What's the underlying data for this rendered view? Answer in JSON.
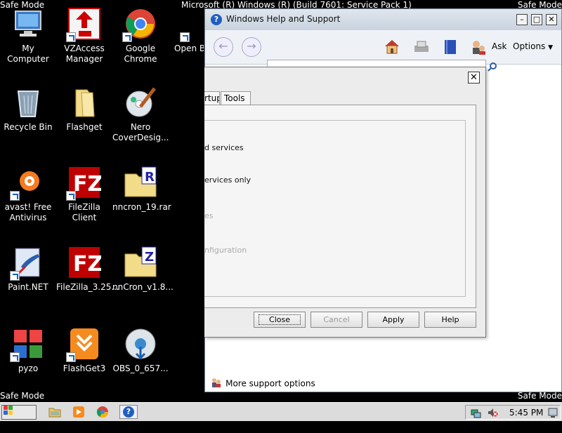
{
  "desktop": {
    "safe_mode": "Safe Mode",
    "os_title": "Microsoft (R) Windows (R) (Build 7601: Service Pack 1)",
    "icons": [
      {
        "label": "My Computer"
      },
      {
        "label": "VZAccess Manager"
      },
      {
        "label": "Google Chrome"
      },
      {
        "label": "Open Broadca"
      },
      {
        "label": "Recycle Bin"
      },
      {
        "label": "Flashget"
      },
      {
        "label": "Nero CoverDesig..."
      },
      {
        "label": "avast! Free Antivirus"
      },
      {
        "label": "FileZilla Client"
      },
      {
        "label": "nncron_19.rar"
      },
      {
        "label": "Paint.NET"
      },
      {
        "label": "FileZilla_3.25..."
      },
      {
        "label": "nnCron_v1.8..."
      },
      {
        "label": "pyzo"
      },
      {
        "label": "FlashGet3"
      },
      {
        "label": "OBS_0_657..."
      }
    ]
  },
  "help_window": {
    "title": "Windows Help and Support",
    "ask_label": "Ask",
    "options_label": "Options",
    "more_support": "More support options"
  },
  "dialog": {
    "tabs": [
      "rtup",
      "Tools"
    ],
    "options": [
      {
        "text": "d services",
        "enabled": true
      },
      {
        "text": "ervices only",
        "enabled": true
      },
      {
        "text": "es",
        "enabled": false
      },
      {
        "text": "nfiguration",
        "enabled": false
      }
    ],
    "buttons": {
      "close": "Close",
      "cancel": "Cancel",
      "apply": "Apply",
      "help": "Help"
    }
  },
  "taskbar": {
    "start_label": "Start",
    "clock": "5:45 PM"
  },
  "colors": {
    "desktop": "#000000",
    "taskbar": "#dcdcdc",
    "help_titlebar": "#c9d3de"
  }
}
